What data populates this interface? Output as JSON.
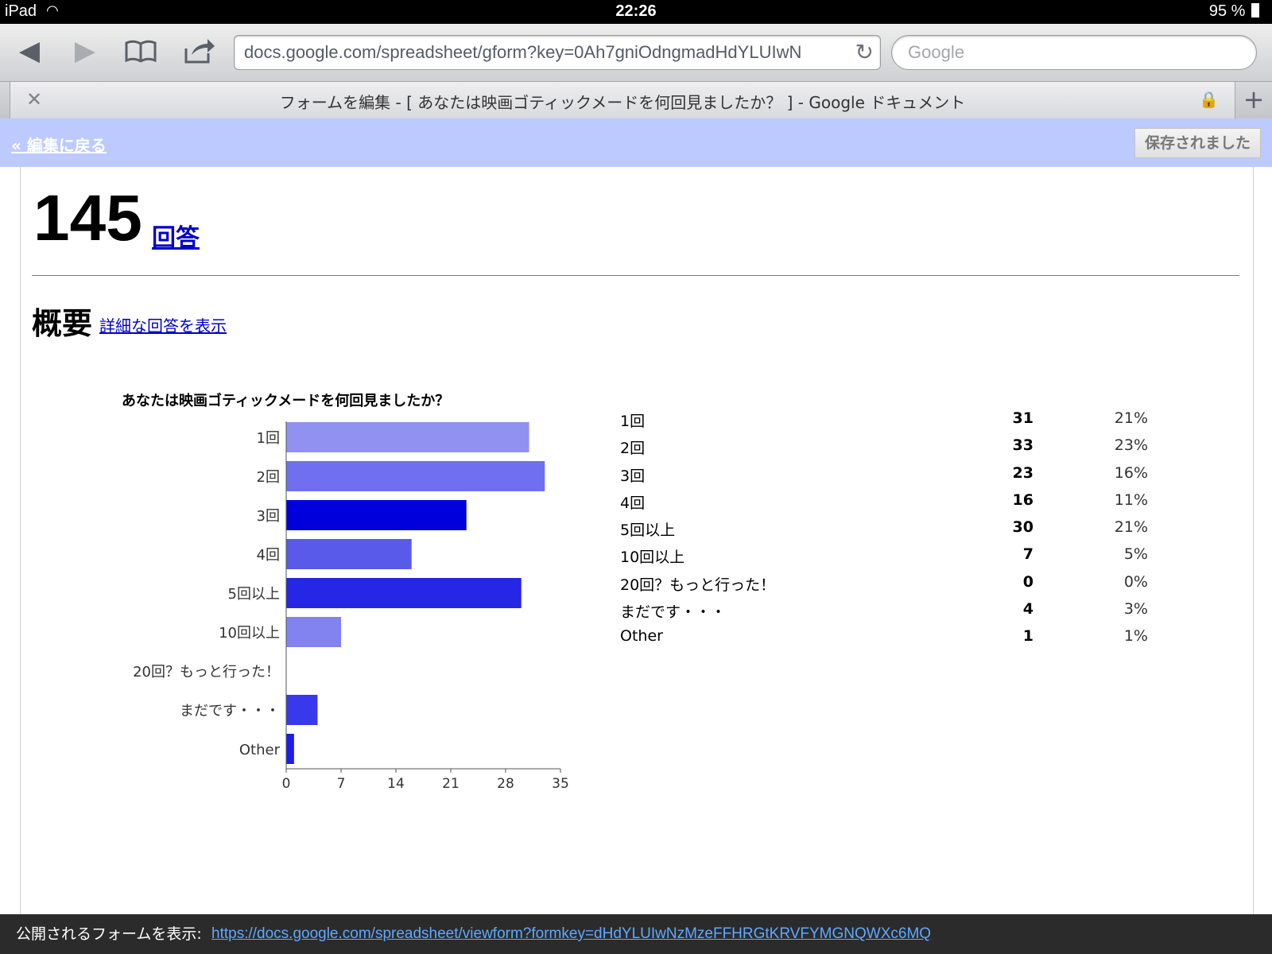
{
  "status_bar": {
    "device": "iPad",
    "time": "22:26",
    "battery": "95 %"
  },
  "browser": {
    "url": "docs.google.com/spreadsheet/gform?key=0Ah7gniOdngmadHdYLUIwN",
    "search_placeholder": "Google",
    "tab_title": "フォームを編集 - [ あなたは映画ゴティックメードを何回見ましたか？ ] - Google ドキュメント"
  },
  "form_bar": {
    "back_label": "« 編集に戻る",
    "saved_label": "保存されました"
  },
  "responses": {
    "count": "145",
    "link_label": "回答"
  },
  "summary": {
    "title": "概要",
    "detail_link": "詳細な回答を表示"
  },
  "question": {
    "title": "あなたは映画ゴティックメードを何回見ましたか？"
  },
  "table": [
    {
      "label": "1回",
      "count": "31",
      "percent": "21%"
    },
    {
      "label": "2回",
      "count": "33",
      "percent": "23%"
    },
    {
      "label": "3回",
      "count": "23",
      "percent": "16%"
    },
    {
      "label": "4回",
      "count": "16",
      "percent": "11%"
    },
    {
      "label": "5回以上",
      "count": "30",
      "percent": "21%"
    },
    {
      "label": "10回以上",
      "count": "7",
      "percent": "5%"
    },
    {
      "label": "20回？もっと行った！",
      "count": "0",
      "percent": "0%"
    },
    {
      "label": "まだです・・・",
      "count": "4",
      "percent": "3%"
    },
    {
      "label": "Other",
      "count": "1",
      "percent": "1%"
    }
  ],
  "chart_data": {
    "type": "bar",
    "orientation": "horizontal",
    "categories": [
      "1回",
      "2回",
      "3回",
      "4回",
      "5回以上",
      "10回以上",
      "20回？もっと行った！",
      "まだです・・・",
      "Other"
    ],
    "values": [
      31,
      33,
      23,
      16,
      30,
      7,
      0,
      4,
      1
    ],
    "colors": [
      "#9191f1",
      "#6f6fef",
      "#0000dd",
      "#5a5aea",
      "#2626e6",
      "#8282f0",
      "#3a3aee",
      "#3838ec",
      "#1c1cee"
    ],
    "xlim": [
      0,
      35
    ],
    "xticks": [
      "0",
      "7",
      "14",
      "21",
      "28",
      "35"
    ],
    "grid": false,
    "legend": "none"
  },
  "footer": {
    "label": "公開されるフォームを表示:",
    "url": "https://docs.google.com/spreadsheet/viewform?formkey=dHdYLUIwNzMzeFFHRGtKRVFYMGNQWXc6MQ"
  }
}
